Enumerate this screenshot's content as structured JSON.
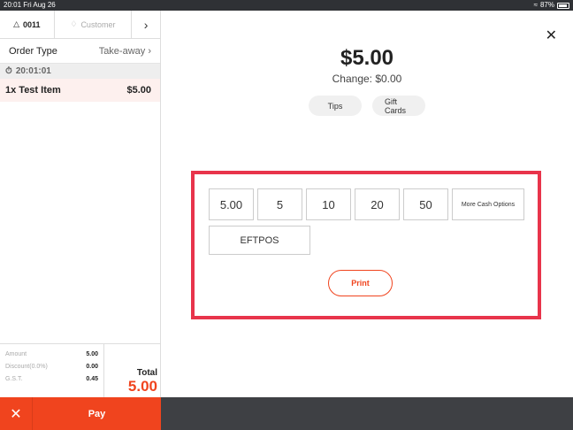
{
  "statusbar": {
    "time": "20:01",
    "date": "Fri Aug 26",
    "battery": "87%"
  },
  "left": {
    "table_number": "0011",
    "customer_label": "Customer",
    "order_type_label": "Order Type",
    "order_type_value": "Take-away",
    "time": "20:01:01",
    "items": [
      {
        "label": "1x Test Item",
        "price": "$5.00"
      }
    ],
    "summary": {
      "amount_label": "Amount",
      "amount": "5.00",
      "discount_label": "Discount(0.0%)",
      "discount": "0.00",
      "gst_label": "G.S.T.",
      "gst": "0.45",
      "total_label": "Total",
      "total": "5.00"
    },
    "pay_label": "Pay"
  },
  "main": {
    "amount": "$5.00",
    "change": "Change: $0.00",
    "tips_label": "Tips",
    "giftcards_label": "Gift Cards",
    "cash_options": [
      "5.00",
      "5",
      "10",
      "20",
      "50"
    ],
    "more_cash_label": "More Cash Options",
    "eftpos_label": "EFTPOS",
    "print_label": "Print"
  },
  "colors": {
    "accent": "#f0441e",
    "highlight_border": "#e8344b"
  }
}
